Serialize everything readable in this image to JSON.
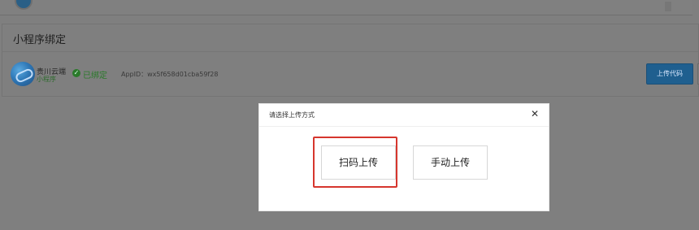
{
  "card": {
    "title": "小程序绑定",
    "app": {
      "name": "贵川云端",
      "subtitle": "小程序",
      "status": "已绑定",
      "appid_label": "AppID：",
      "appid_value": "wx5f658d01cba59f28"
    },
    "upload_button": "上传代码"
  },
  "dialog": {
    "title": "请选择上传方式",
    "options": [
      {
        "label": "扫码上传"
      },
      {
        "label": "手动上传"
      }
    ],
    "highlight_color": "#d6362e"
  },
  "icons": {
    "close": "close-icon",
    "check": "check-circle-icon",
    "logo": "app-logo-icon"
  }
}
